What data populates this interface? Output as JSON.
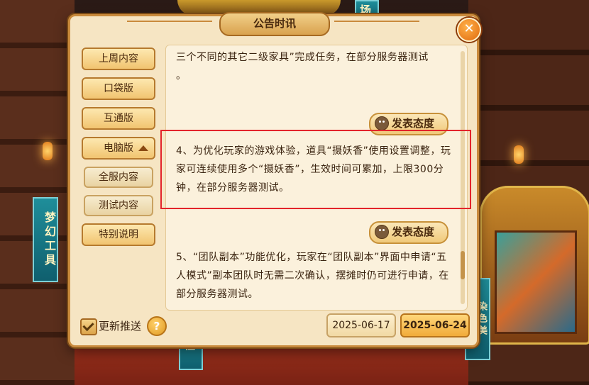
{
  "background": {
    "banner_left": "梦幻工具",
    "banner_right": "染色美",
    "banner_top": "场",
    "banner_bottom": "程"
  },
  "dialog": {
    "title": "公告时讯",
    "close_label": "✕"
  },
  "sidebar": {
    "items": [
      {
        "label": "上周内容"
      },
      {
        "label": "口袋版"
      },
      {
        "label": "互通版"
      },
      {
        "label": "电脑版"
      }
    ],
    "subitems": [
      {
        "label": "全服内容"
      },
      {
        "label": "测试内容"
      }
    ],
    "special": {
      "label": "特别说明"
    }
  },
  "content": {
    "para_top_1": "三个不同的其它二级家具”完成任务，在部分服务器测试",
    "para_top_2": "。",
    "para_4": "4、为优化玩家的游戏体验，道具“摄妖香”使用设置调整，玩家可连续使用多个“摄妖香”，生效时间可累加，上限300分钟，在部分服务器测试。",
    "para_5": "5、“团队副本”功能优化，玩家在“团队副本”界面中申请“五人模式”副本团队时无需二次确认，摆摊时仍可进行申请，在部分服务器测试。",
    "react_label": "发表态度"
  },
  "footer": {
    "checkbox_label": "更新推送",
    "help_label": "?",
    "date_prev": "2025-06-17",
    "date_current": "2025-06-24"
  },
  "colors": {
    "highlight_box": "#e3242b",
    "dialog_bg": "#f6e5c3",
    "accent": "#f1ab3a"
  }
}
